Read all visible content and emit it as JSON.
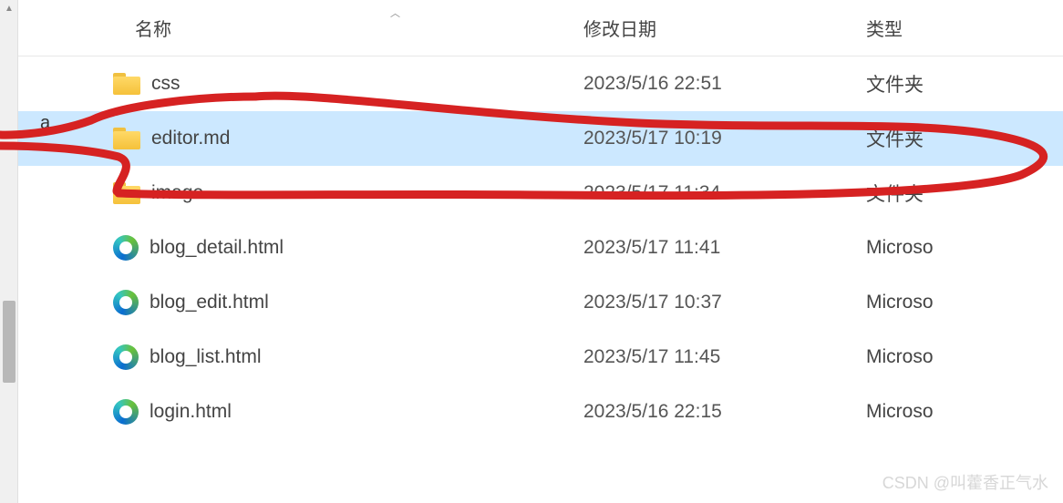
{
  "header": {
    "name": "名称",
    "date": "修改日期",
    "type": "类型"
  },
  "rows": [
    {
      "icon": "folder",
      "name": "css",
      "date": "2023/5/16 22:51",
      "type": "文件夹",
      "selected": false
    },
    {
      "icon": "folder",
      "name": "editor.md",
      "date": "2023/5/17 10:19",
      "type": "文件夹",
      "selected": true
    },
    {
      "icon": "folder",
      "name": "image",
      "date": "2023/5/17 11:34",
      "type": "文件夹",
      "selected": false
    },
    {
      "icon": "edge",
      "name": "blog_detail.html",
      "date": "2023/5/17 11:41",
      "type": "Microso",
      "selected": false
    },
    {
      "icon": "edge",
      "name": "blog_edit.html",
      "date": "2023/5/17 10:37",
      "type": "Microso",
      "selected": false
    },
    {
      "icon": "edge",
      "name": "blog_list.html",
      "date": "2023/5/17 11:45",
      "type": "Microso",
      "selected": false
    },
    {
      "icon": "edge",
      "name": "login.html",
      "date": "2023/5/16 22:15",
      "type": "Microso",
      "selected": false
    }
  ],
  "watermark": "CSDN @叫藿香正气水",
  "artifact_letter": "a"
}
